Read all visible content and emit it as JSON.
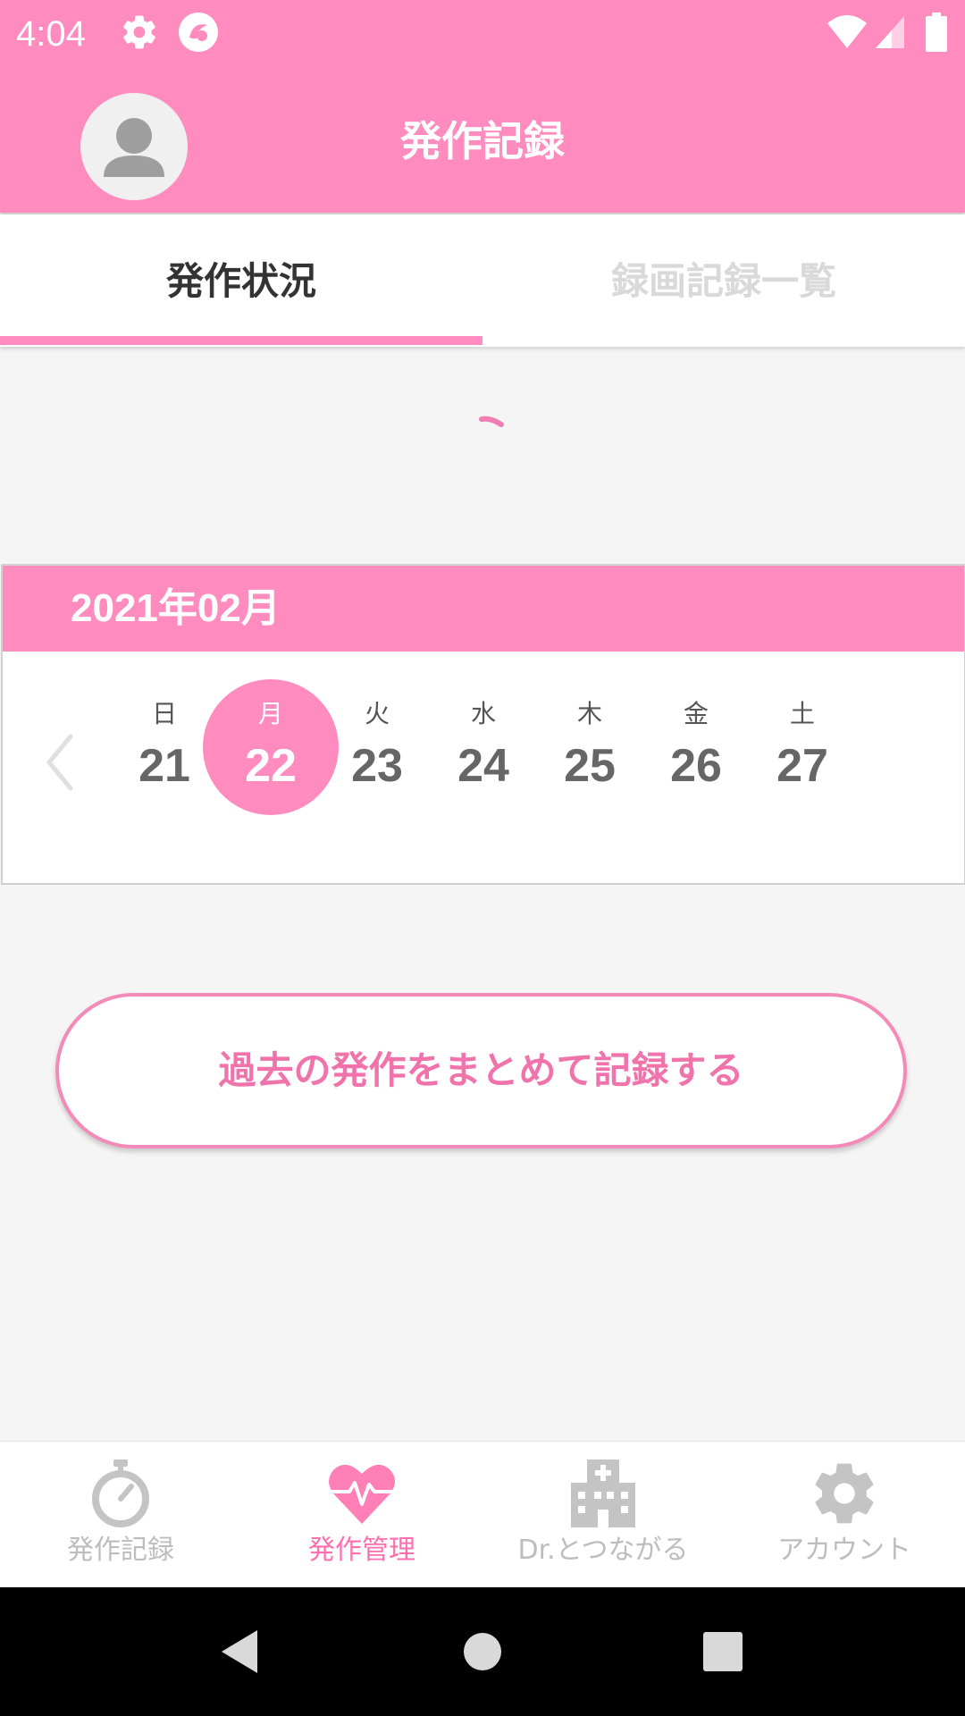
{
  "status_bar": {
    "time": "4:04"
  },
  "app_bar": {
    "title": "発作記録"
  },
  "tabs": [
    {
      "label": "発作状況",
      "active": true
    },
    {
      "label": "録画記録一覧",
      "active": false
    }
  ],
  "calendar": {
    "month_label": "2021年02月",
    "days": [
      {
        "dow": "日",
        "num": "21"
      },
      {
        "dow": "月",
        "num": "22",
        "selected": true
      },
      {
        "dow": "火",
        "num": "23"
      },
      {
        "dow": "水",
        "num": "24"
      },
      {
        "dow": "木",
        "num": "25"
      },
      {
        "dow": "金",
        "num": "26"
      },
      {
        "dow": "土",
        "num": "27"
      }
    ]
  },
  "bulk_record_button": {
    "label": "過去の発作をまとめて記録する"
  },
  "bottom_nav": [
    {
      "label": "発作記録",
      "icon": "stopwatch-icon",
      "active": false
    },
    {
      "label": "発作管理",
      "icon": "heartbeat-icon",
      "active": true
    },
    {
      "label": "Dr.とつながる",
      "icon": "hospital-icon",
      "active": false
    },
    {
      "label": "アカウント",
      "icon": "gear-icon",
      "active": false
    }
  ],
  "colors": {
    "accent": "#ff8bbf",
    "inactive": "#bdbdbd",
    "background": "#f5f5f5"
  }
}
